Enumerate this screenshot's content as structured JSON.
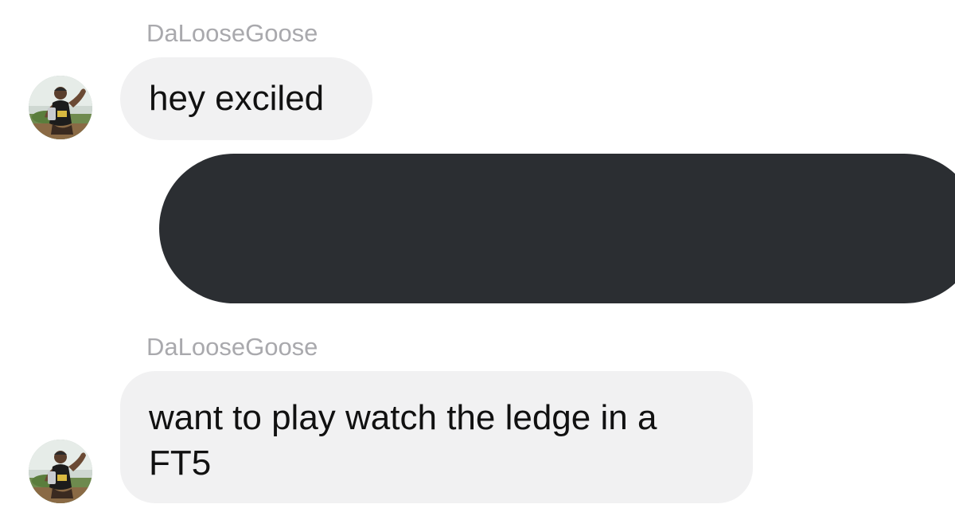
{
  "conversation": {
    "messages": [
      {
        "sender": "DaLooseGoose",
        "text": "hey exciled",
        "avatar": "profile-photo"
      },
      {
        "sender": "self",
        "text": "",
        "redacted": true,
        "color": "#2b2e32"
      },
      {
        "sender": "DaLooseGoose",
        "lines": [
          "want to play watch the ledge in a",
          "FT5"
        ],
        "avatar": "profile-photo"
      }
    ]
  },
  "colors": {
    "incoming_bubble": "#f1f1f2",
    "sender_name": "#a9a9ad",
    "outgoing_bubble": "#2b2e32"
  }
}
